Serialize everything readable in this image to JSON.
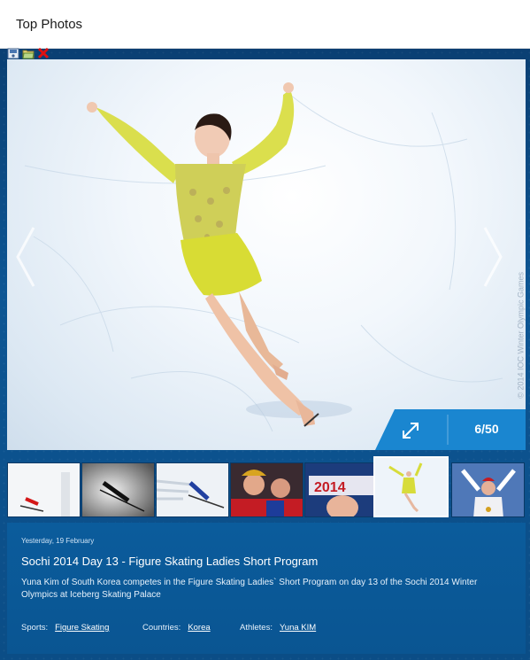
{
  "header": {
    "title": "Top Photos"
  },
  "toolbar": {
    "icons": [
      "save-icon",
      "open-folder-icon",
      "close-icon"
    ]
  },
  "photo": {
    "credit": "© 2014 IOC Winter Olympic Games",
    "counter": "6/50",
    "alt": "Figure skater in yellow dress"
  },
  "thumbnails": [
    {
      "name": "ski-jumper-red"
    },
    {
      "name": "ski-jumper-silhouette"
    },
    {
      "name": "skier-motion-blur"
    },
    {
      "name": "russian-fans"
    },
    {
      "name": "sochi-2014-fan"
    },
    {
      "name": "figure-skater-yellow",
      "active": true
    },
    {
      "name": "athlete-celebrating"
    }
  ],
  "caption": {
    "date": "Yesterday, 19 February",
    "title": "Sochi 2014 Day 13 - Figure Skating Ladies Short Program",
    "description": "Yuna Kim of South Korea competes in the Figure Skating Ladies` Short Program on day 13 of the Sochi 2014 Winter Olympics at Iceberg Skating Palace",
    "sports_label": "Sports:",
    "sports_value": "Figure Skating",
    "countries_label": "Countries:",
    "countries_value": "Korea",
    "athletes_label": "Athletes:",
    "athletes_value": "Yuna KIM"
  },
  "colors": {
    "accent": "#0b5c9c",
    "counter_bg": "#1a86d0",
    "dress": "#d7dc3a"
  }
}
